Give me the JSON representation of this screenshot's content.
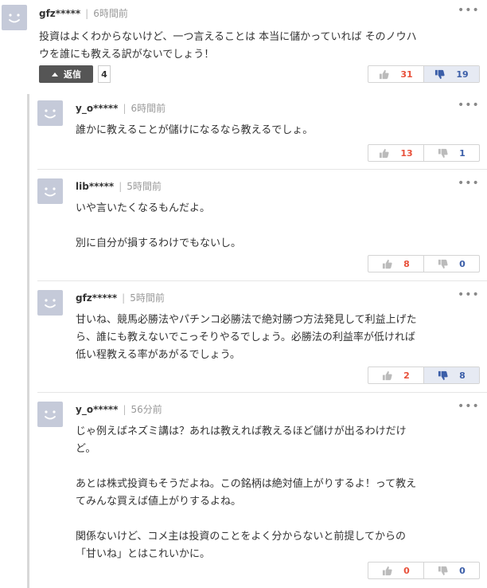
{
  "comments": [
    {
      "user": "gfz*****",
      "time": "6時間前",
      "text": "投資はよくわからないけど、一つ言えることは 本当に儲かっていれば そのノウハ\nウを誰にも教える訳がないでしょう！",
      "likes": "31",
      "dislikes": "19",
      "reply_label": "返信",
      "reply_count": "4"
    },
    {
      "user": "y_o*****",
      "time": "6時間前",
      "text": "誰かに教えることが儲けになるなら教えるでしょ。",
      "likes": "13",
      "dislikes": "1"
    },
    {
      "user": "lib*****",
      "time": "5時間前",
      "text": "いや言いたくなるもんだよ。\n\n別に自分が損するわけでもないし。",
      "likes": "8",
      "dislikes": "0"
    },
    {
      "user": "gfz*****",
      "time": "5時間前",
      "text": "甘いね、競馬必勝法やパチンコ必勝法で絶対勝つ方法発見して利益上げた\nら、誰にも教えないでこっそりやるでしょう。必勝法の利益率が低ければ\n低い程教える率があがるでしょう。",
      "likes": "2",
      "dislikes": "8"
    },
    {
      "user": "y_o*****",
      "time": "56分前",
      "text": "じゃ例えばネズミ講は？あれは教えれば教えるほど儲けが出るわけだけ\nど。\n\nあとは株式投資もそうだよね。この銘柄は絶対値上がりするよ！って教え\nてみんな買えば値上がりするよね。\n\n関係ないけど、コメ主は投資のことをよく分からないと前提してからの\n「甘いね」とはこれいかに。",
      "likes": "0",
      "dislikes": "0"
    }
  ],
  "more_label": "•••",
  "colors": {
    "like": "#e8503a",
    "dislike": "#3b5ea8",
    "avatar": "#c5cad9"
  },
  "icons": {
    "like": "thumbs-up-icon",
    "dislike": "thumbs-down-icon",
    "reply": "caret-up-icon",
    "more": "more-icon",
    "avatar": "avatar-icon"
  }
}
